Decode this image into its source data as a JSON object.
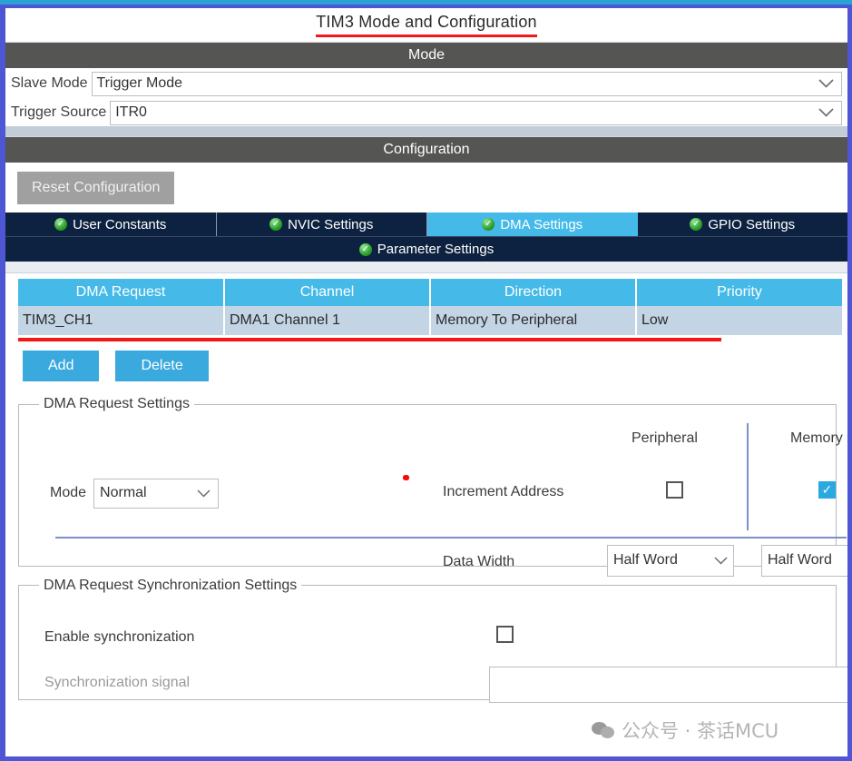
{
  "window": {
    "title": "TIM3 Mode and Configuration"
  },
  "colors": {
    "accent_blue": "#45bae8",
    "tab_dark": "#0d2240",
    "section_grey": "#555553",
    "underline_red": "#ef1b1b",
    "frame_purple": "#4f56d4",
    "row_select": "#c3d4e4"
  },
  "mode_section": {
    "header": "Mode",
    "fields": [
      {
        "label": "Slave Mode",
        "value": "Trigger Mode",
        "chevron": "chevron-down-icon"
      },
      {
        "label": "Trigger Source",
        "value": "ITR0",
        "chevron": "chevron-down-icon"
      }
    ]
  },
  "configuration_section": {
    "header": "Configuration",
    "reset_button": "Reset Configuration",
    "tabs": [
      {
        "label": "User Constants",
        "icon": "check-circle-icon",
        "active": false
      },
      {
        "label": "NVIC Settings",
        "icon": "check-circle-icon",
        "active": false
      },
      {
        "label": "DMA Settings",
        "icon": "check-circle-icon",
        "active": true
      },
      {
        "label": "GPIO Settings",
        "icon": "check-circle-icon",
        "active": false
      }
    ],
    "subtab": {
      "label": "Parameter Settings",
      "icon": "check-circle-icon"
    }
  },
  "dma_table": {
    "columns": [
      "DMA Request",
      "Channel",
      "Direction",
      "Priority"
    ],
    "rows": [
      [
        "TIM3_CH1",
        "DMA1 Channel 1",
        "Memory To Peripheral",
        "Low"
      ]
    ]
  },
  "table_buttons": {
    "add": "Add",
    "delete": "Delete"
  },
  "request_settings": {
    "legend": "DMA Request Settings",
    "column_headers": {
      "peripheral": "Peripheral",
      "memory": "Memory"
    },
    "mode": {
      "label": "Mode",
      "value": "Normal",
      "chevron": "chevron-down-icon"
    },
    "increment_address": {
      "label": "Increment Address",
      "peripheral_checked": false,
      "memory_checked": true
    },
    "data_width": {
      "label": "Data Width",
      "peripheral_value": "Half Word",
      "memory_value": "Half Word",
      "chevron": "chevron-down-icon"
    }
  },
  "sync_settings": {
    "legend": "DMA Request Synchronization Settings",
    "enable": {
      "label": "Enable synchronization",
      "checked": false
    },
    "signal": {
      "label": "Synchronization signal",
      "value": "",
      "chevron": "chevron-down-icon"
    }
  },
  "watermark": {
    "text": "公众号 · 茶话MCU",
    "icon": "wechat-icon"
  }
}
